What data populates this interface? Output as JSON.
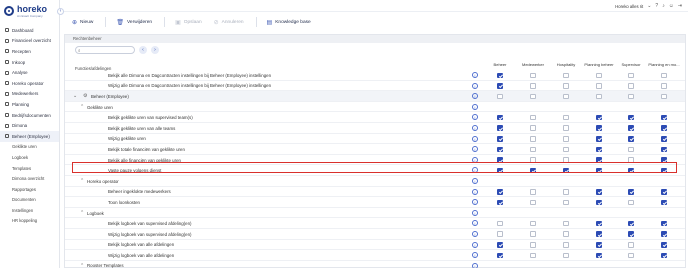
{
  "sidebar": {
    "logo_name": "horeko",
    "logo_sub": "An Exact Company",
    "collapse_icon": "chevron-left-icon",
    "items": [
      {
        "label": "Dashboard",
        "icon": "dashboard-icon"
      },
      {
        "label": "Financieel overzicht",
        "icon": "chart-icon"
      },
      {
        "label": "Recepten",
        "icon": "recipe-icon"
      },
      {
        "label": "Inkoop",
        "icon": "cart-icon"
      },
      {
        "label": "Analyse",
        "icon": "analysis-icon"
      },
      {
        "label": "Horeko operator",
        "icon": "operator-icon"
      },
      {
        "label": "Medewerkers",
        "icon": "users-icon"
      },
      {
        "label": "Planning",
        "icon": "calendar-icon"
      },
      {
        "label": "Bedrijfsdocumenten",
        "icon": "document-icon"
      },
      {
        "label": "Dimona",
        "icon": "dimona-icon"
      },
      {
        "label": "Beheer (Employee)",
        "icon": "settings-icon"
      }
    ],
    "subitems": [
      "Gekliktе uren",
      "Logboek",
      "Templates",
      "Dimona overzicht",
      "Rapportages",
      "Documenten",
      "Instellingen",
      "HR koppeling"
    ]
  },
  "topbar": {
    "company": "Horeko alles rit",
    "icons": [
      "chevron-down-icon",
      "help-icon",
      "bell-icon",
      "user-icon",
      "logout-icon"
    ]
  },
  "toolbar": {
    "nieuw": "Nieuw",
    "verwijderen": "Verwijderen",
    "opslaan": "Opslaan",
    "annuleren": "Annuleren",
    "knowledge": "Knowledge base"
  },
  "panel": {
    "title": "Rechtenbeheer",
    "function_label": "Functies/afdelingen",
    "columns": [
      "Beheer",
      "Medewerker",
      "Hospitality",
      "Planning beheer",
      "Supervisor",
      "Planning en mo..."
    ]
  },
  "rows": [
    {
      "type": "item",
      "level": 2,
      "label": "Bekijk alle Dimona en Dagcontracten instellingen bij Beheer (Employee) instellingen",
      "checks": [
        1,
        0,
        0,
        0,
        0,
        0
      ]
    },
    {
      "type": "item",
      "level": 2,
      "label": "Wijzig alle Dimona en Dagcontracten instellingen bij Beheer (Employee) instellingen",
      "checks": [
        1,
        0,
        0,
        0,
        0,
        0
      ]
    },
    {
      "type": "group",
      "level": 0,
      "label": "Beheer (Employee)",
      "checks": [
        0,
        0,
        0,
        0,
        0,
        0
      ]
    },
    {
      "type": "sub",
      "level": 1,
      "label": "Geklikte uren",
      "checks": null
    },
    {
      "type": "item",
      "level": 2,
      "label": "Bekijk geklikte uren van supervised team(s)",
      "checks": [
        1,
        0,
        0,
        1,
        1,
        1
      ]
    },
    {
      "type": "item",
      "level": 2,
      "label": "Bekijk geklikte uren van alle teams",
      "checks": [
        1,
        0,
        0,
        1,
        1,
        1
      ]
    },
    {
      "type": "item",
      "level": 2,
      "label": "Wijzig geklikte uren",
      "checks": [
        1,
        0,
        0,
        1,
        1,
        1
      ]
    },
    {
      "type": "item",
      "level": 2,
      "label": "Bekijk totale financiën van geklikte uren",
      "checks": [
        1,
        0,
        0,
        1,
        0,
        1
      ]
    },
    {
      "type": "item",
      "level": 2,
      "label": "Bekijk alle financiën van geklikte uren",
      "checks": [
        1,
        0,
        0,
        1,
        0,
        1
      ]
    },
    {
      "type": "item",
      "level": 2,
      "label": "Vaste pauze volgens dienst",
      "checks": [
        1,
        1,
        1,
        1,
        1,
        1
      ],
      "highlighted": true
    },
    {
      "type": "sub",
      "level": 1,
      "label": "Horeko operator",
      "checks": null
    },
    {
      "type": "item",
      "level": 2,
      "label": "Beheer ingeklokte medewerkers",
      "checks": [
        1,
        0,
        0,
        1,
        1,
        1
      ]
    },
    {
      "type": "item",
      "level": 2,
      "label": "Toon loonkosten",
      "checks": [
        1,
        0,
        0,
        1,
        0,
        1
      ]
    },
    {
      "type": "sub",
      "level": 1,
      "label": "Logboek",
      "checks": null
    },
    {
      "type": "item",
      "level": 2,
      "label": "Bekijk logboek van supervised afdeling(en)",
      "checks": [
        0,
        0,
        0,
        1,
        1,
        1
      ]
    },
    {
      "type": "item",
      "level": 2,
      "label": "Wijzig logboek van supervised afdeling(en)",
      "checks": [
        0,
        0,
        0,
        1,
        1,
        1
      ]
    },
    {
      "type": "item",
      "level": 2,
      "label": "Bekijk logboek van alle afdelingen",
      "checks": [
        1,
        0,
        0,
        1,
        0,
        1
      ]
    },
    {
      "type": "item",
      "level": 2,
      "label": "Wijzig logboek van alle afdelingen",
      "checks": [
        1,
        0,
        0,
        1,
        0,
        1
      ]
    },
    {
      "type": "sub",
      "level": 1,
      "label": "Rooster Templates",
      "checks": null
    }
  ]
}
